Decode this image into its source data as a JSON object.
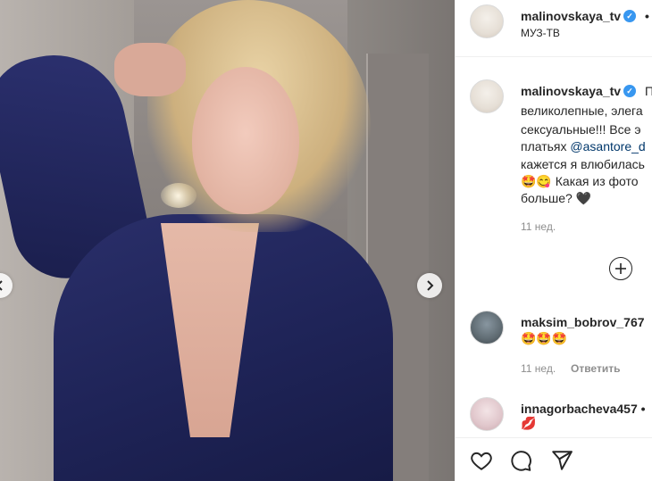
{
  "post": {
    "username": "malinovskaya_tv",
    "header_dot": "•",
    "location": "МУЗ-ТВ",
    "caption_lines": [
      "великолепные, элега",
      "сексуальные!!! Все э",
      "платьях ",
      "кажется я влюбилась",
      "Какая из фото",
      "больше?"
    ],
    "caption_first_char": "П",
    "mention": "@asantore_d",
    "emoji_line": "🤩😋",
    "heart": "🖤",
    "time": "11 нед."
  },
  "comments": [
    {
      "username": "maksim_bobrov_767",
      "text": "🤩🤩🤩",
      "time": "11 нед.",
      "reply": "Ответить"
    },
    {
      "username": "innagorbacheva457",
      "text": "💋",
      "suffix": "•"
    }
  ],
  "icons": {
    "verified": "verified-badge-icon",
    "prev": "chevron-left-icon",
    "next": "chevron-right-icon",
    "more_replies": "plus-circle-icon",
    "like": "heart-icon",
    "comment": "comment-icon",
    "share": "send-icon"
  },
  "colors": {
    "accent": "#3897f0",
    "mention": "#00376b",
    "meta": "#8e8e8e"
  }
}
